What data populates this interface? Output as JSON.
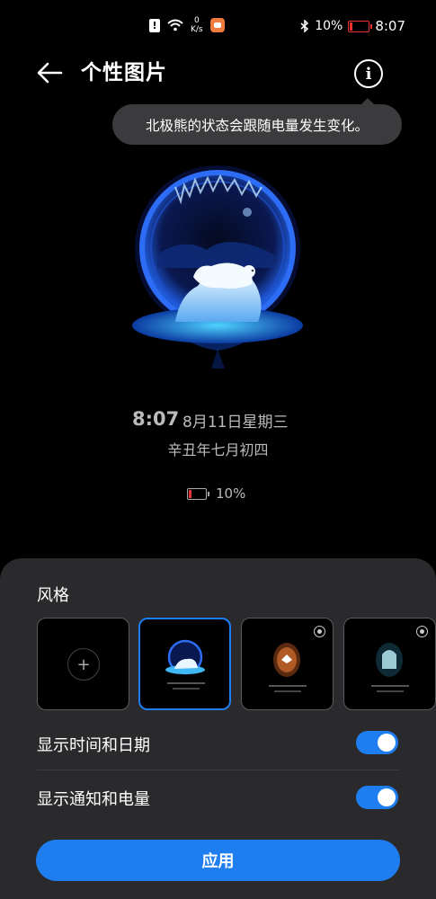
{
  "status_bar": {
    "warn_icon": "!",
    "net_speed_value": "0",
    "net_speed_unit": "K/s",
    "battery_percent": "10%",
    "time": "8:07"
  },
  "header": {
    "title": "个性图片",
    "info_symbol": "i"
  },
  "tooltip": {
    "text": "北极熊的状态会跟随电量发生变化。"
  },
  "preview": {
    "time": "8:07",
    "date": "8月11日星期三",
    "lunar": "辛丑年七月初四",
    "battery": "10%"
  },
  "sheet": {
    "style_label": "风格",
    "thumbnails": [
      {
        "name": "add",
        "plus": "+",
        "selected": false
      },
      {
        "name": "polar-bear",
        "selected": true
      },
      {
        "name": "bird",
        "selected": false
      },
      {
        "name": "ice-bear",
        "selected": false
      }
    ],
    "show_time_date_label": "显示时间和日期",
    "show_notify_battery_label": "显示通知和电量",
    "show_time_date_on": true,
    "show_notify_battery_on": true,
    "apply_label": "应用"
  },
  "colors": {
    "accent": "#1e7ef0",
    "sheet_bg": "#2a2a2c",
    "battery_low": "#e33333"
  }
}
